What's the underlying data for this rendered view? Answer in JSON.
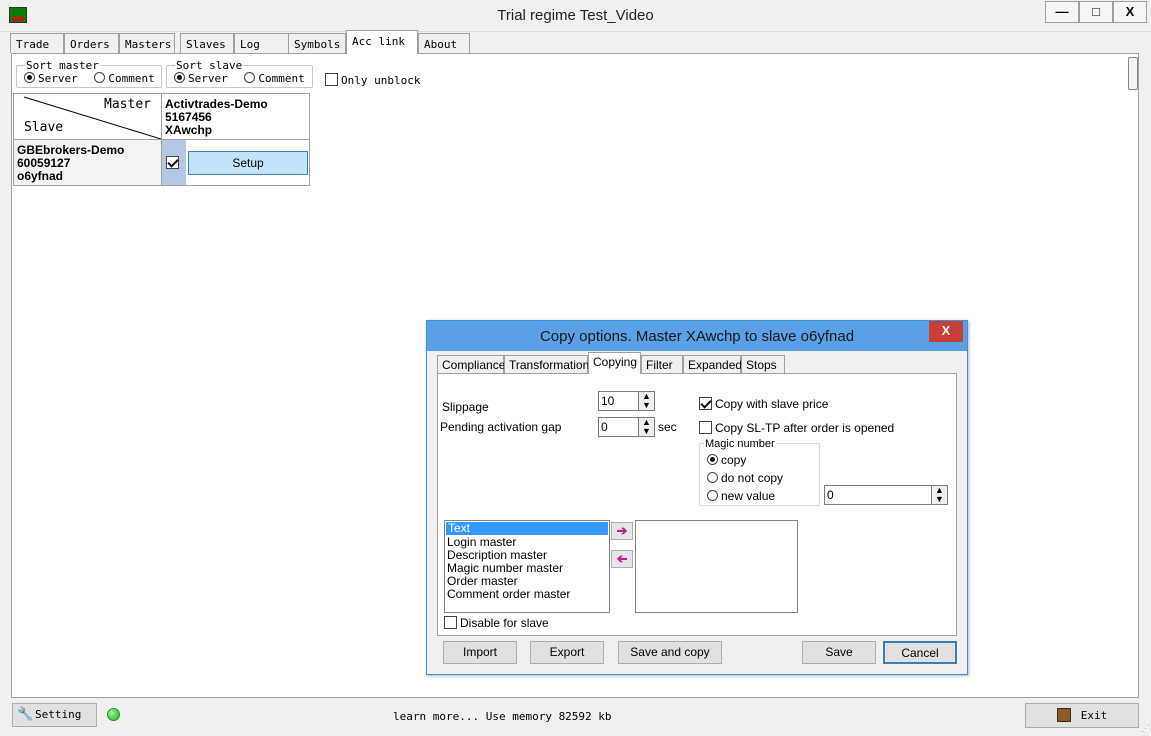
{
  "window": {
    "title": "Trial regime Test_Video",
    "minimize": "—",
    "maximize": "□",
    "close": "X"
  },
  "tabs": [
    "Trade",
    "Orders",
    "Masters",
    "Slaves",
    "Log",
    "Symbols",
    "Acc link",
    "About"
  ],
  "active_tab": "Acc link",
  "sort_master": {
    "legend": "Sort master",
    "options": [
      "Server",
      "Comment"
    ],
    "selected": "Server"
  },
  "sort_slave": {
    "legend": "Sort slave",
    "options": [
      "Server",
      "Comment"
    ],
    "selected": "Server"
  },
  "only_unblock": {
    "label": "Only unblock",
    "checked": false
  },
  "grid": {
    "corner_master": "Master",
    "corner_slave": "Slave",
    "master": {
      "server": "Activtrades-Demo",
      "login": "5167456",
      "comment": "XAwchp"
    },
    "slave": {
      "server": "GBEbrokers-Demo",
      "login": "60059127",
      "comment": "o6yfnad"
    },
    "link_checked": true,
    "setup_label": "Setup"
  },
  "statusbar": {
    "setting_label": "Setting",
    "message": "learn more... Use memory 82592 kb",
    "exit_label": "Exit"
  },
  "dialog": {
    "title": "Copy options. Master XAwchp to slave o6yfnad",
    "close": "X",
    "tabs": [
      "Compliance",
      "Transformation",
      "Copying",
      "Filter",
      "Expanded",
      "Stops"
    ],
    "active_tab": "Copying",
    "slippage": {
      "label": "Slippage",
      "value": "10"
    },
    "pending_gap": {
      "label": "Pending activation gap",
      "value": "0",
      "unit": "sec"
    },
    "copy_with_slave_price": {
      "label": "Copy with slave price",
      "checked": true
    },
    "copy_sltp": {
      "label": "Copy SL-TP after order is opened",
      "checked": false
    },
    "magic": {
      "legend": "Magic number",
      "options": [
        "copy",
        "do not copy",
        "new value"
      ],
      "selected": "copy",
      "new_value": "0"
    },
    "available_fields": [
      "Text",
      "Login master",
      "Description master",
      "Magic number master",
      "Order master",
      "Comment order master"
    ],
    "selected_field": "Text",
    "disable_for_slave": {
      "label": "Disable for slave",
      "checked": false
    },
    "buttons": {
      "import": "Import",
      "export": "Export",
      "save_and_copy": "Save and copy",
      "save": "Save",
      "cancel": "Cancel"
    }
  }
}
